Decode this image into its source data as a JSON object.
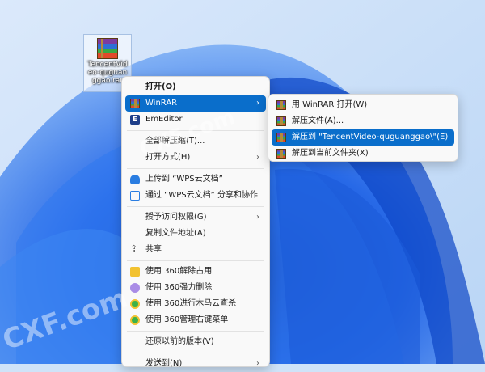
{
  "desktop": {
    "icon_label": "TencentVideo-quguanggao.rar"
  },
  "context_menu": {
    "items": [
      {
        "label": "打开(O)",
        "bold": true
      },
      {
        "label": "WinRAR"
      },
      {
        "label": "EmEditor"
      },
      {
        "label": "全部解压缩(T)..."
      },
      {
        "label": "打开方式(H)"
      },
      {
        "label": "上传到 “WPS云文档”"
      },
      {
        "label": "通过 “WPS云文档” 分享和协作"
      },
      {
        "label": "授予访问权限(G)"
      },
      {
        "label": "复制文件地址(A)"
      },
      {
        "label": "共享"
      },
      {
        "label": "使用 360解除占用"
      },
      {
        "label": "使用 360强力删除"
      },
      {
        "label": "使用 360进行木马云查杀"
      },
      {
        "label": "使用 360管理右键菜单"
      },
      {
        "label": "还原以前的版本(V)"
      },
      {
        "label": "发送到(N)"
      }
    ]
  },
  "winrar_submenu": {
    "items": [
      {
        "label": "用 WinRAR 打开(W)"
      },
      {
        "label": "解压文件(A)..."
      },
      {
        "label": "解压到 \"TencentVideo-quguanggao\\\"(E)"
      },
      {
        "label": "解压到当前文件夹(X)"
      }
    ]
  },
  "watermarks": [
    "CXF.com",
    "CXF.com"
  ],
  "colors": {
    "selection": "#0a6ecb",
    "wallpaper_blue": "#1f5fe0"
  }
}
